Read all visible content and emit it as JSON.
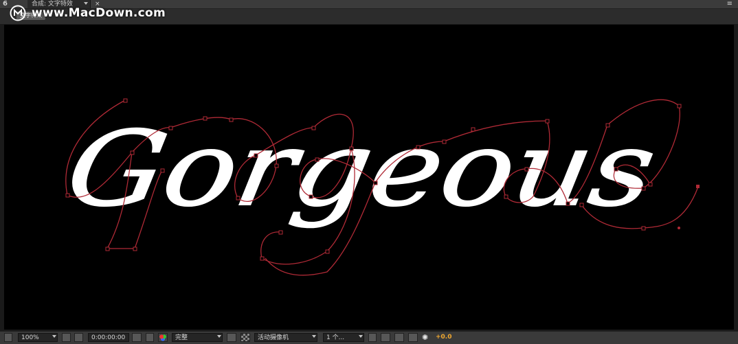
{
  "panel": {
    "number": "6",
    "tab_title": "合成: 文字特效",
    "close_glyph": "×",
    "menu_glyph": "≡"
  },
  "breadcrumb": {
    "label": "文字特效"
  },
  "watermark": {
    "text": "www.MacDown.com"
  },
  "viewer": {
    "text": "Gorgeous",
    "background": "#000000",
    "text_color": "#ffffff",
    "path_color": "#b02a36"
  },
  "toolbar": {
    "zoom": "100%",
    "timecode": "0:00:00:00",
    "resolution": "完整",
    "camera": "活动摄像机",
    "views": "1 个...",
    "exposure": "+0.0",
    "icons": [
      "region-of-interest-icon",
      "transparency-grid-icon",
      "snapshot-icon",
      "show-snapshot-icon",
      "color-channel-icon",
      "fast-preview-icon",
      "pixel-aspect-icon",
      "flowchart-icon",
      "exposure-reset-icon"
    ]
  }
}
